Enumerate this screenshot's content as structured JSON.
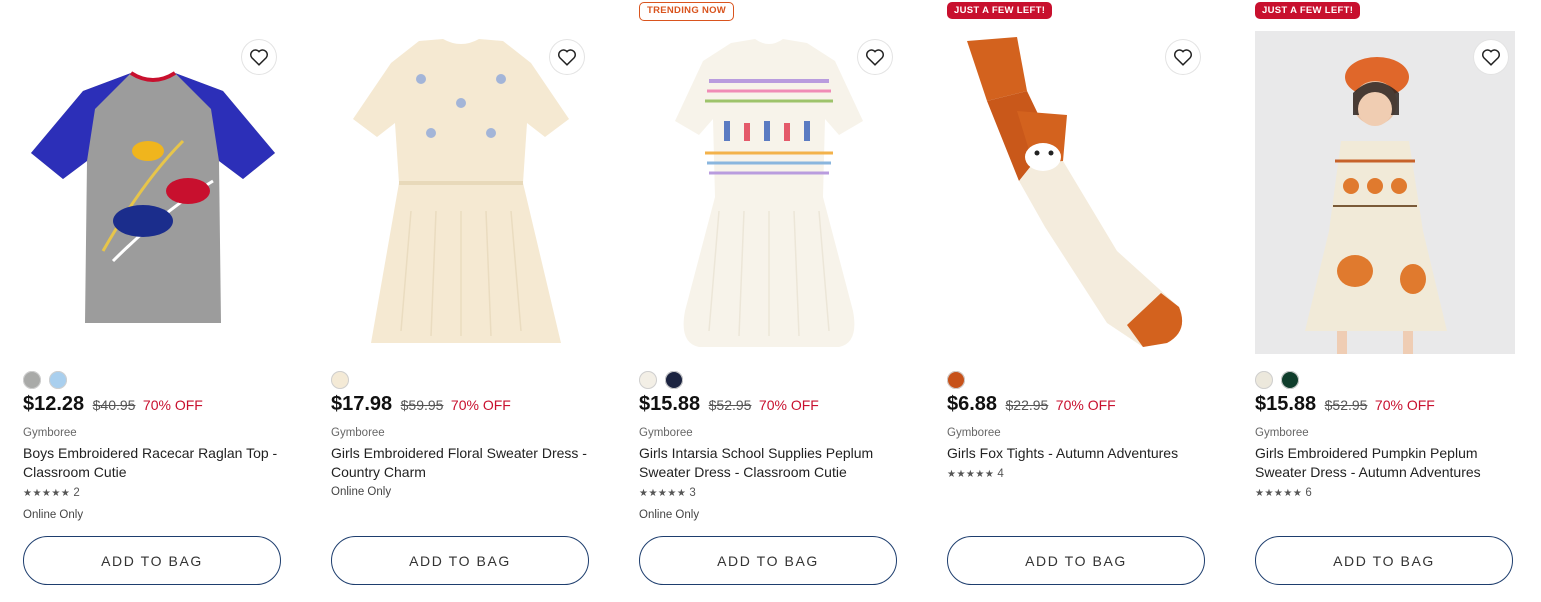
{
  "products": [
    {
      "badge": "",
      "swatches": [
        "#a9aaa8",
        "#a9cfee"
      ],
      "price": "$12.28",
      "old_price": "$40.95",
      "discount": "70% OFF",
      "brand": "Gymboree",
      "title": "Boys Embroidered Racecar Raglan Top - Classroom Cutie",
      "stars": "★★★★★",
      "rating_count": "2",
      "online_only": "Online Only",
      "add_to_bag": "ADD TO BAG"
    },
    {
      "badge": "",
      "swatches": [
        "#f4ead6"
      ],
      "price": "$17.98",
      "old_price": "$59.95",
      "discount": "70% OFF",
      "brand": "Gymboree",
      "title": "Girls Embroidered Floral Sweater Dress - Country Charm",
      "stars": "",
      "rating_count": "",
      "online_only": "Online Only",
      "add_to_bag": "ADD TO BAG"
    },
    {
      "badge": "TRENDING NOW",
      "swatches": [
        "#f3efe6",
        "#1b2340"
      ],
      "price": "$15.88",
      "old_price": "$52.95",
      "discount": "70% OFF",
      "brand": "Gymboree",
      "title": "Girls Intarsia School Supplies Peplum Sweater Dress - Classroom Cutie",
      "stars": "★★★★★",
      "rating_count": "3",
      "online_only": "Online Only",
      "add_to_bag": "ADD TO BAG"
    },
    {
      "badge": "JUST A FEW LEFT!",
      "swatches": [
        "#c7521a"
      ],
      "price": "$6.88",
      "old_price": "$22.95",
      "discount": "70% OFF",
      "brand": "Gymboree",
      "title": "Girls Fox Tights - Autumn Adventures",
      "stars": "★★★★★",
      "rating_count": "4",
      "online_only": "",
      "add_to_bag": "ADD TO BAG"
    },
    {
      "badge": "JUST A FEW LEFT!",
      "swatches": [
        "#ece8dc",
        "#0f3d2b"
      ],
      "price": "$15.88",
      "old_price": "$52.95",
      "discount": "70% OFF",
      "brand": "Gymboree",
      "title": "Girls Embroidered Pumpkin Peplum Sweater Dress - Autumn Adventures",
      "stars": "★★★★★",
      "rating_count": "6",
      "online_only": "",
      "add_to_bag": "ADD TO BAG"
    }
  ],
  "colors": {
    "accent_red": "#c8102e",
    "trend_orange": "#d9541e",
    "button_border": "#1e3e6e"
  }
}
